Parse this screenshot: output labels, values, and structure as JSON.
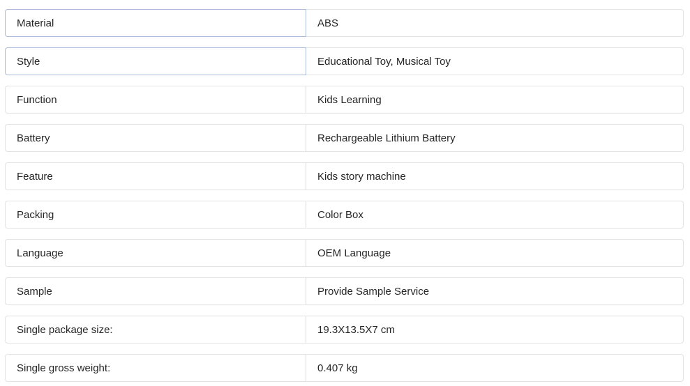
{
  "specs": [
    {
      "label": "Material",
      "value": "ABS"
    },
    {
      "label": "Style",
      "value": "Educational Toy, Musical Toy"
    },
    {
      "label": "Function",
      "value": "Kids Learning"
    },
    {
      "label": "Battery",
      "value": "Rechargeable Lithium Battery"
    },
    {
      "label": "Feature",
      "value": "Kids story machine"
    },
    {
      "label": "Packing",
      "value": "Color Box"
    },
    {
      "label": "Language",
      "value": "OEM Language"
    },
    {
      "label": "Sample",
      "value": "Provide Sample Service"
    },
    {
      "label": "Single package size:",
      "value": "19.3X13.5X7 cm"
    },
    {
      "label": "Single gross weight:",
      "value": "0.407 kg"
    }
  ]
}
